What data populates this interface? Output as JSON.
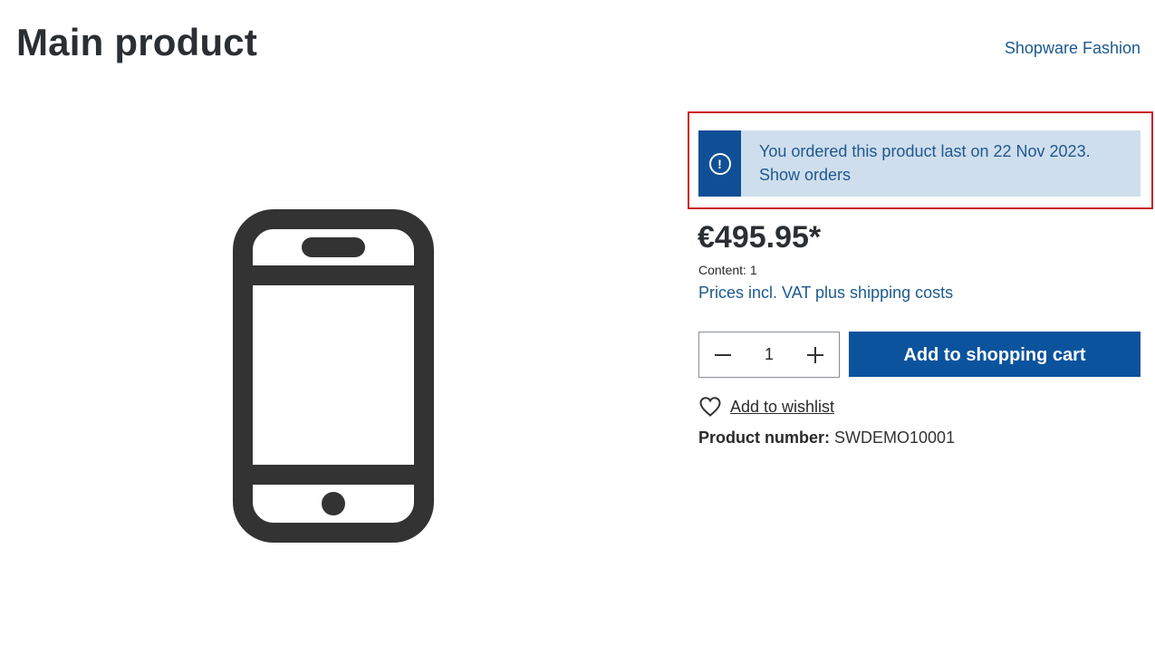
{
  "header": {
    "title": "Main product",
    "manufacturer": "Shopware Fashion"
  },
  "gallery": {
    "icon": "smartphone-icon"
  },
  "alert": {
    "icon": "info-circle-icon",
    "message": "You ordered this product last on 22 Nov 2023.",
    "link_text": "Show orders",
    "highlight_color": "#cc1f1f",
    "background_color": "#cfdeec",
    "icon_column_color": "#0f4f96"
  },
  "buy_box": {
    "price": "€495.95*",
    "content": "Content: 1",
    "tax_note": "Prices incl. VAT plus shipping costs",
    "quantity": "1",
    "add_to_cart_label": "Add to shopping cart",
    "add_to_cart_color": "#0b539d",
    "wishlist_label": "Add to wishlist",
    "product_number_label": "Product number:",
    "product_number_value": "SWDEMO10001"
  }
}
